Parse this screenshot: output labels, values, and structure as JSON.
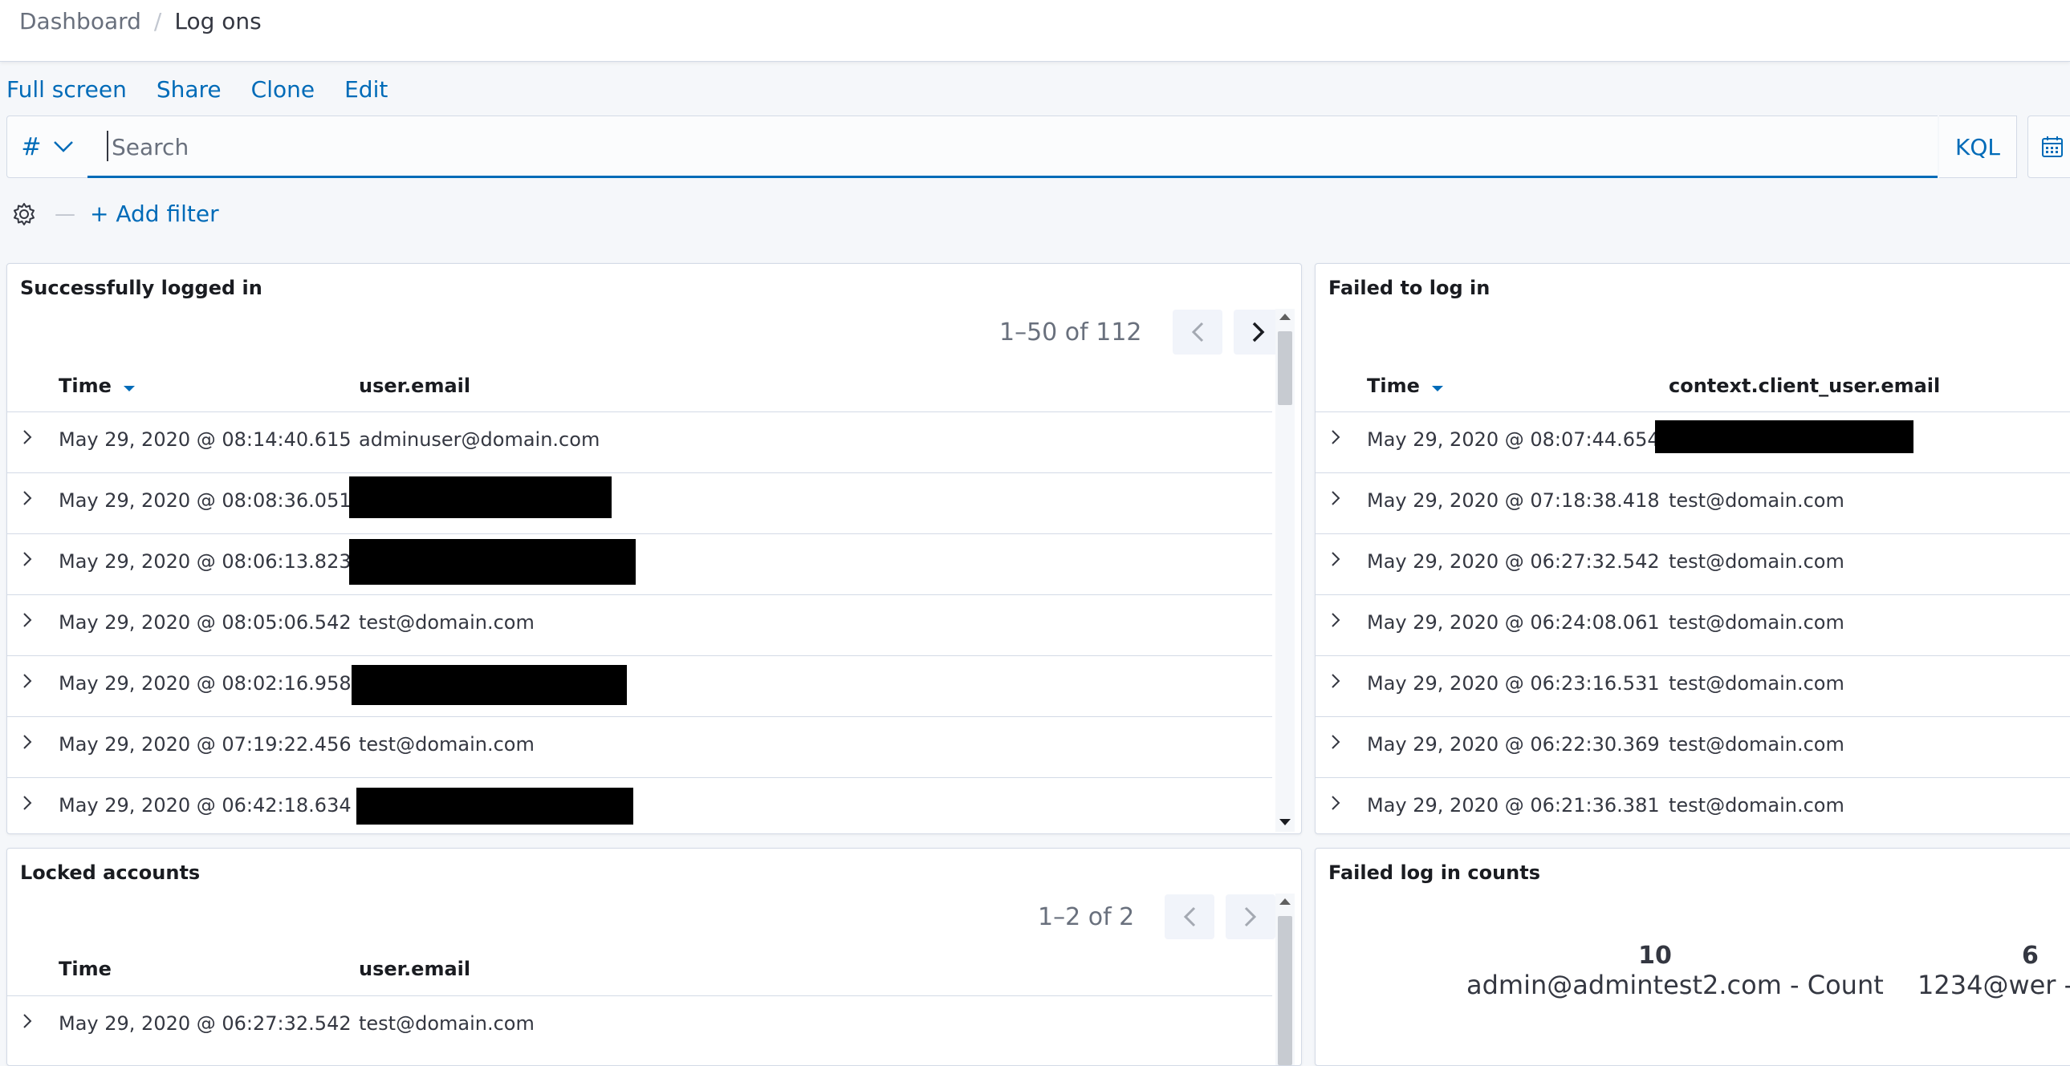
{
  "breadcrumb": {
    "root": "Dashboard",
    "separator": "/",
    "current": "Log ons"
  },
  "actions": {
    "full_screen": "Full screen",
    "share": "Share",
    "clone": "Clone",
    "edit": "Edit"
  },
  "query": {
    "language_symbol": "#",
    "placeholder": "Search",
    "value": "",
    "kql": "KQL"
  },
  "filters": {
    "add_filter": "+ Add filter"
  },
  "panels": {
    "success": {
      "title": "Successfully logged in",
      "pagination": "1–50 of 112",
      "columns": [
        "Time",
        "user.email"
      ],
      "rows": [
        {
          "time": "May 29, 2020 @ 08:14:40.615",
          "email": "adminuser@domain.com",
          "redacted": false
        },
        {
          "time": "May 29, 2020 @ 08:08:36.051",
          "email": "",
          "redacted": true
        },
        {
          "time": "May 29, 2020 @ 08:06:13.823",
          "email": "",
          "redacted": true
        },
        {
          "time": "May 29, 2020 @ 08:05:06.542",
          "email": "test@domain.com",
          "redacted": false
        },
        {
          "time": "May 29, 2020 @ 08:02:16.958",
          "email": "",
          "redacted": true
        },
        {
          "time": "May 29, 2020 @ 07:19:22.456",
          "email": "test@domain.com",
          "redacted": false
        },
        {
          "time": "May 29, 2020 @ 06:42:18.634",
          "email": "",
          "redacted": true
        }
      ]
    },
    "failed": {
      "title": "Failed to log in",
      "columns": [
        "Time",
        "context.client_user.email"
      ],
      "rows": [
        {
          "time": "May 29, 2020 @ 08:07:44.654",
          "email": "",
          "redacted": true
        },
        {
          "time": "May 29, 2020 @ 07:18:38.418",
          "email": "test@domain.com",
          "redacted": false
        },
        {
          "time": "May 29, 2020 @ 06:27:32.542",
          "email": "test@domain.com",
          "redacted": false
        },
        {
          "time": "May 29, 2020 @ 06:24:08.061",
          "email": "test@domain.com",
          "redacted": false
        },
        {
          "time": "May 29, 2020 @ 06:23:16.531",
          "email": "test@domain.com",
          "redacted": false
        },
        {
          "time": "May 29, 2020 @ 06:22:30.369",
          "email": "test@domain.com",
          "redacted": false
        },
        {
          "time": "May 29, 2020 @ 06:21:36.381",
          "email": "test@domain.com",
          "redacted": false
        }
      ]
    },
    "locked": {
      "title": "Locked accounts",
      "pagination": "1–2 of 2",
      "columns": [
        "Time",
        "user.email"
      ],
      "rows": [
        {
          "time": "May 29, 2020 @ 06:27:32.542",
          "email": "test@domain.com",
          "redacted": false
        }
      ]
    },
    "failed_counts": {
      "title": "Failed log in counts",
      "metrics": [
        {
          "value": "10",
          "label": "admin@admintest2.com - Count"
        },
        {
          "value": "6",
          "label": "1234@wer -"
        }
      ]
    }
  },
  "colors": {
    "accent": "#006bb8",
    "text": "#343741",
    "subdued": "#69707d",
    "border": "#d3dae6",
    "background": "#f5f7fa",
    "redaction": "#000000"
  }
}
